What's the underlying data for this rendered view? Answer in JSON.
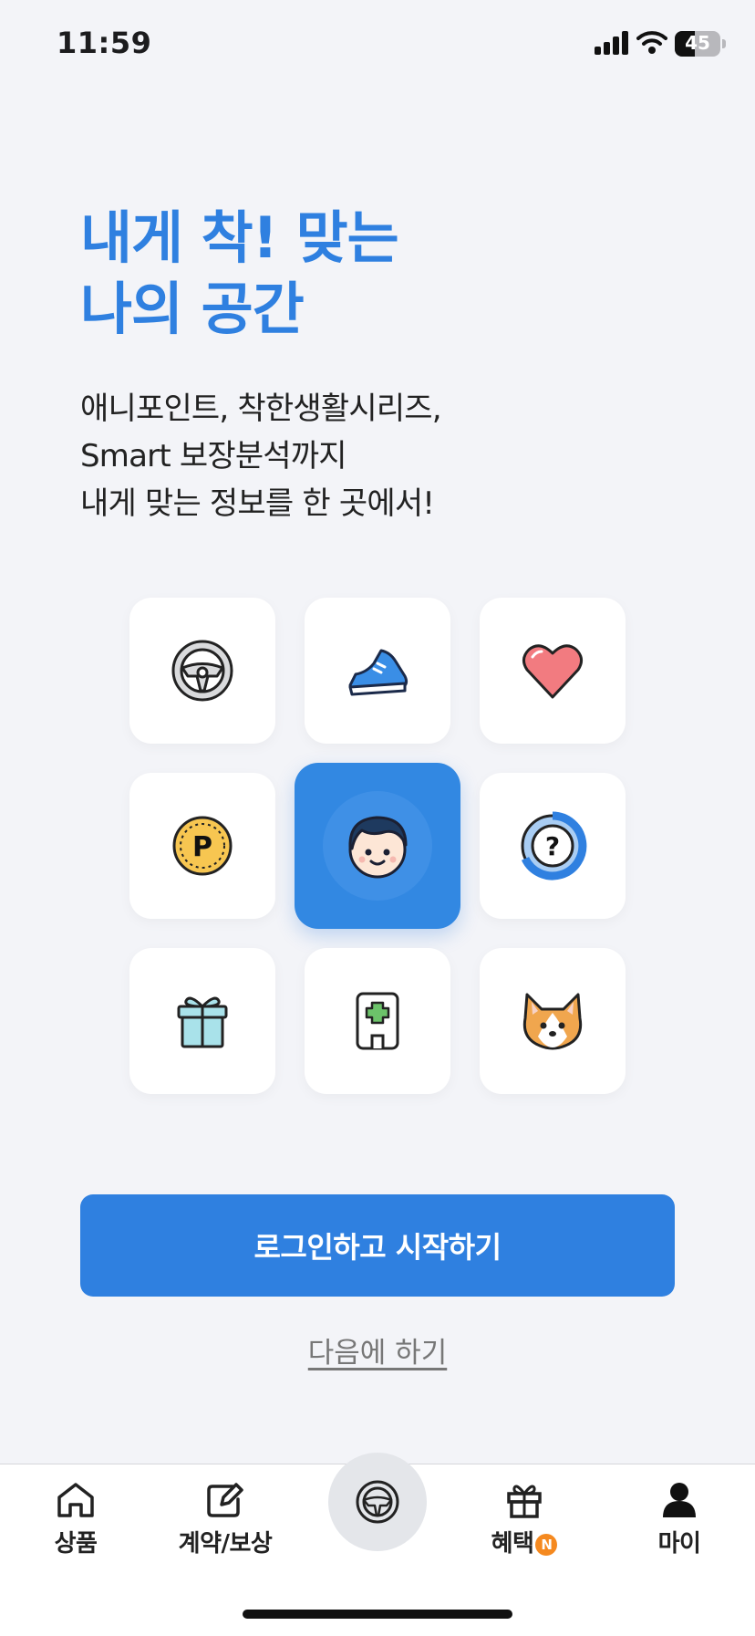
{
  "status_bar": {
    "time": "11:59",
    "battery": "45"
  },
  "hero": {
    "title_lines": [
      "내게 착! 맞는",
      "나의 공간"
    ],
    "desc_lines": [
      "애니포인트, 착한생활시리즈,",
      "Smart 보장분석까지",
      "내게 맞는 정보를 한 곳에서!"
    ]
  },
  "grid_icons": [
    "steering-wheel-icon",
    "sneaker-icon",
    "heart-icon",
    "point-coin-icon",
    "user-avatar-icon",
    "question-chart-icon",
    "gift-icon",
    "hospital-icon",
    "dog-icon"
  ],
  "actions": {
    "login": "로그인하고 시작하기",
    "later": "다음에 하기"
  },
  "tabbar": {
    "items": [
      {
        "label": "상품",
        "icon": "home-icon"
      },
      {
        "label": "계약/보상",
        "icon": "edit-icon"
      },
      {
        "label": "",
        "icon": "steering-wheel-icon"
      },
      {
        "label": "혜택",
        "icon": "gift-icon",
        "badge": "N"
      },
      {
        "label": "마이",
        "icon": "person-icon"
      }
    ]
  },
  "colors": {
    "accent": "#2f80e0",
    "background": "#f3f4f8",
    "badge": "#f5891f"
  }
}
